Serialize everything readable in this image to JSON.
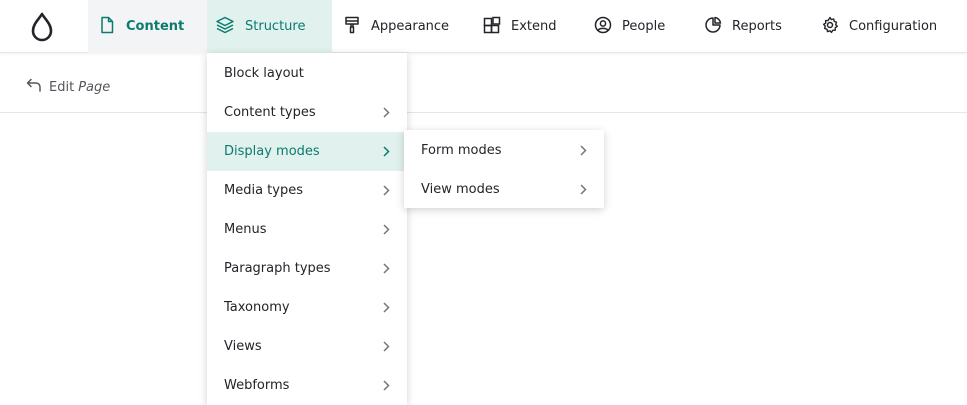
{
  "toolbar": {
    "tabs": [
      {
        "label": "Content",
        "icon": "document-icon"
      },
      {
        "label": "Structure",
        "icon": "layers-icon"
      },
      {
        "label": "Appearance",
        "icon": "paint-brush-icon"
      },
      {
        "label": "Extend",
        "icon": "puzzle-blocks-icon"
      },
      {
        "label": "People",
        "icon": "user-circle-icon"
      },
      {
        "label": "Reports",
        "icon": "pie-chart-icon"
      },
      {
        "label": "Configuration",
        "icon": "gear-icon"
      }
    ]
  },
  "subheader": {
    "edit_label": "Edit",
    "page_label": "Page"
  },
  "structure_menu": {
    "items": [
      {
        "label": "Block layout",
        "has_submenu": false
      },
      {
        "label": "Content types",
        "has_submenu": true
      },
      {
        "label": "Display modes",
        "has_submenu": true,
        "active": true
      },
      {
        "label": "Media types",
        "has_submenu": true
      },
      {
        "label": "Menus",
        "has_submenu": true
      },
      {
        "label": "Paragraph types",
        "has_submenu": true
      },
      {
        "label": "Taxonomy",
        "has_submenu": true
      },
      {
        "label": "Views",
        "has_submenu": true
      },
      {
        "label": "Webforms",
        "has_submenu": true
      }
    ]
  },
  "display_modes_submenu": {
    "items": [
      {
        "label": "Form modes",
        "has_submenu": true
      },
      {
        "label": "View modes",
        "has_submenu": true
      }
    ]
  },
  "colors": {
    "accent": "#0b7b6e",
    "active_background": "#e1f1ee",
    "text": "#232429"
  }
}
